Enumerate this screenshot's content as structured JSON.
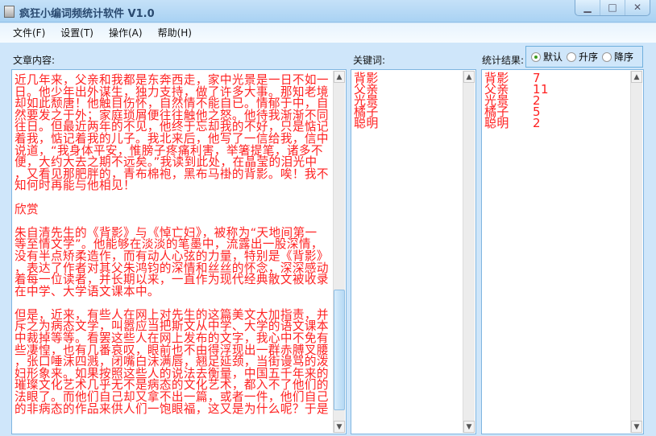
{
  "window": {
    "title": "疯狂小编词频统计软件 V1.0"
  },
  "menu": [
    "文件(F)",
    "设置(T)",
    "操作(A)",
    "帮助(H)"
  ],
  "labels": {
    "content": "文章内容:",
    "keywords": "关键词:",
    "results": "统计结果:"
  },
  "sort_options": [
    {
      "label": "默认",
      "selected": true
    },
    {
      "label": "升序",
      "selected": false
    },
    {
      "label": "降序",
      "selected": false
    }
  ],
  "article_text": "近几年来，父亲和我都是东奔西走，家中光景是一日不如一\n日。他少年出外谋生，独力支持，做了许多大事。那知老境\n却如此颓唐！他触目伤怀，自然情不能自已。情郁于中，自\n然要发之于外；家庭琐屑便往往触他之怒。他待我渐渐不同\n往日。但最近两年的不见，他终于忘却我的不好，只是惦记\n着我，惦记着我的儿子。我北来后，他写了一信给我，信中\n说道，“我身体平安，惟膀子疼痛利害，举箸提笔，诸多不\n便，大约大去之期不远矣。”我读到此处，在晶莹的泪光中\n，又看见那肥胖的，青布棉袍，黑布马褂的背影。唉！我不\n知何时再能与他相见！\n\n欣赏\n\n朱自清先生的《背影》与《悼亡妇》，被称为“天地间第一\n等至情文学”。他能够在淡淡的笔墨中，流露出一股深情，\n没有半点矫柔造作，而有动人心弦的力量，特别是《背影》\n，表达了作者对其父朱鸿钧的深情和丝丝的怀念，深深感动\n着每一位读者，并长期以来，一直作为现代经典散文被收录\n在中学、大学语文课本中。\n\n但是，近来，有些人在网上对先生的这篇美文大加指责，并\n斥之为病态文学，叫嚣应当把斯文从中学、大学的语文课本\n中裁掉等等。看罢这些人在网上发布的文字，我心中不免有\n些凄惶，也有几番哀叹，眼前也不由得浮现出一群赤膊叉腰\n，张口唾沫四溅，闭嘴白沫满唇，翘足延颈，当街谩骂的泼\n妇形象来。如果按照这些人的说法去衡量，中国五千年来的\n璀璨文化艺术几乎无不是病态的文化艺术，都入不了他们的\n法眼了。而他们自己却又拿不出一篇，或者一件，他们自己\n的非病态的作品来供人们一饱眼福，这又是为什么呢？于是",
  "keywords": [
    "背影",
    "父亲",
    "光景",
    "橘子",
    "聪明"
  ],
  "results": [
    {
      "word": "背影",
      "count": "7"
    },
    {
      "word": "父亲",
      "count": "11"
    },
    {
      "word": "光景",
      "count": "2"
    },
    {
      "word": "橘子",
      "count": "5"
    },
    {
      "word": "聪明",
      "count": "2"
    }
  ],
  "colors": {
    "text": "#ff2020",
    "accent": "#7fb5e0"
  }
}
